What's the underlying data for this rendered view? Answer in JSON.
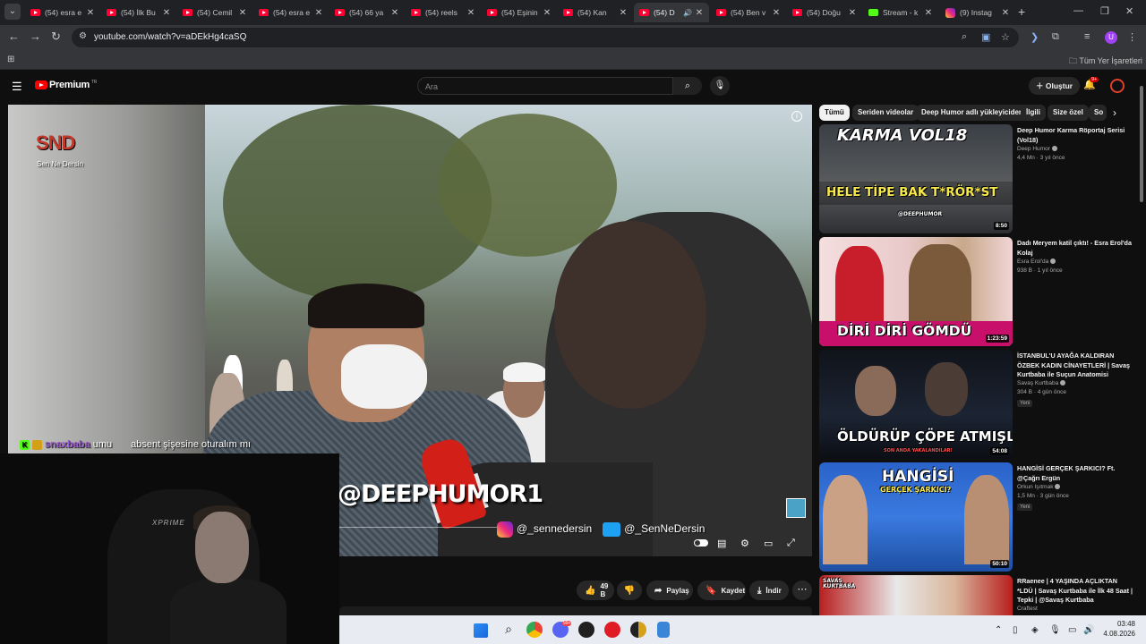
{
  "browser": {
    "tabs": [
      {
        "title": "(54) esra e",
        "icon": "youtube",
        "active": false
      },
      {
        "title": "(54) İlk Bu",
        "icon": "youtube",
        "active": false
      },
      {
        "title": "(54) Cemil",
        "icon": "youtube",
        "active": false
      },
      {
        "title": "(54) esra e",
        "icon": "youtube",
        "active": false
      },
      {
        "title": "(54) 66 ya",
        "icon": "youtube",
        "active": false
      },
      {
        "title": "(54) reels",
        "icon": "youtube",
        "active": false
      },
      {
        "title": "(54) Eşinin",
        "icon": "youtube",
        "active": false
      },
      {
        "title": "(54) Kan",
        "icon": "youtube",
        "active": false
      },
      {
        "title": "(54) D",
        "icon": "youtube",
        "active": true,
        "audio": true
      },
      {
        "title": "(54) Ben v",
        "icon": "youtube",
        "active": false
      },
      {
        "title": "(54) Doğu",
        "icon": "youtube",
        "active": false
      },
      {
        "title": "Stream - k",
        "icon": "kick",
        "active": false
      },
      {
        "title": "(9) Instag",
        "icon": "instagram",
        "active": false
      }
    ],
    "url": "youtube.com/watch?v=aDEkHg4caSQ",
    "avatar_letter": "U",
    "bookmarks_all": "Tüm Yer İşaretleri"
  },
  "youtube": {
    "brand": "Premium",
    "brand_region": "TR",
    "search_placeholder": "Ara",
    "create_label": "Oluştur",
    "notif_badge": "9+",
    "chips": [
      "Tümü",
      "Seriden videolar",
      "Deep Humor adlı yükleyiciden",
      "İlgili",
      "Size özel",
      "So"
    ],
    "actions": {
      "likes": "49 B",
      "share": "Paylaş",
      "save": "Kaydet",
      "download": "İndir"
    }
  },
  "video_overlay": {
    "channel_logo": "SND",
    "channel_logo_sub": "Sen Ne Dersin",
    "watermark": "@DEEPHUMOR1",
    "instagram": "@_sennedersin",
    "twitter": "@_SenNeDersin",
    "chat": {
      "user": "snaxbaba",
      "message_prefix": "umu",
      "message": "absent şişesine oturalım mı"
    },
    "webcam_brand": "XPRIME"
  },
  "related": [
    {
      "title": "Deep Humor Karma Röportaj Serisi (Vol18)",
      "channel": "Deep Humor",
      "meta": "4,4 Mn · 3 yıl önce",
      "duration": "8:50",
      "thumb_text_top": "KARMA VOL18",
      "thumb_text_bottom": "HELE TİPE BAK T*RÖR*ST",
      "thumb_small": "@DEEPHUMOR",
      "badge": ""
    },
    {
      "title": "Dadı Meryem katil çıktı! - Esra Erol'da Kolaj",
      "channel": "Esra Erol'da",
      "meta": "938 B · 1 yıl önce",
      "duration": "1:23:59",
      "thumb_text_top": "",
      "thumb_text_bottom": "DİRİ DİRİ GÖMDÜ",
      "thumb_small": "",
      "badge": ""
    },
    {
      "title": "İSTANBUL'U AYAĞA KALDIRAN ÖZBEK KADIN CİNAYETLERİ | Savaş Kurtbaba ile Suçun Anatomisi",
      "channel": "Savaş Kurtbaba",
      "meta": "304 B · 4 gün önce",
      "duration": "54:08",
      "thumb_text_top": "",
      "thumb_text_bottom": "ÖLDÜRÜP ÇÖPE ATMIŞLAR!",
      "thumb_small": "SON ANDA YAKALANDILAR!",
      "badge": "Yeni"
    },
    {
      "title": "HANGİSİ GERÇEK ŞARKICI? Ft. @Çağrı Ergün",
      "channel": "Orkun Işıtmak",
      "meta": "1,5 Mn · 3 gün önce",
      "duration": "50:10",
      "thumb_text_top": "HANGİSİ",
      "thumb_text_bottom": "GERÇEK ŞARKICI?",
      "thumb_small": "",
      "badge": "Yeni"
    },
    {
      "title": "RRaenee | 4 YAŞINDA AÇLIKTAN *LDÜ | Savaş Kurtbaba ile İlk 48 Saat | Tepki | @Savaş Kurtbaba",
      "channel": "Craftest",
      "meta": "",
      "duration": "",
      "thumb_text_top": "SAVAŞ KURTBABA",
      "thumb_text_bottom": "",
      "thumb_small": "",
      "badge": ""
    }
  ],
  "taskbar": {
    "time": "03:48",
    "date": "4.08.2026",
    "discord_badge": "99+"
  }
}
